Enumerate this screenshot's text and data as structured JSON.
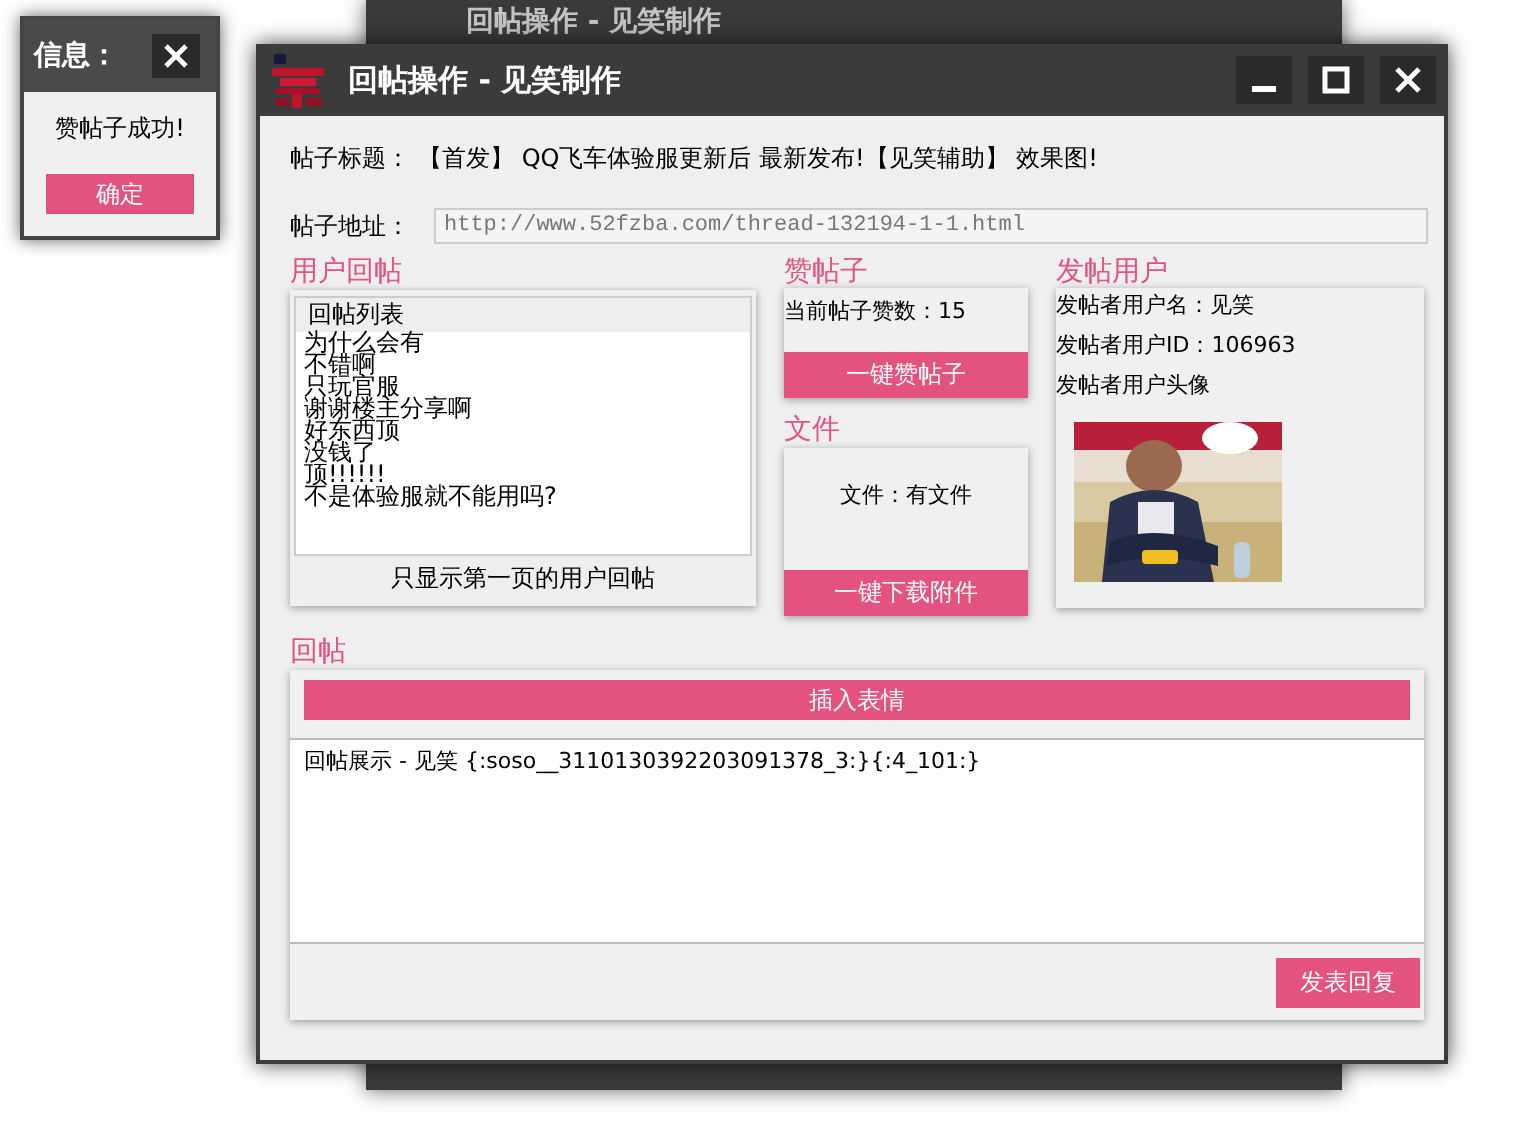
{
  "back_window": {
    "title": "回帖操作 - 见笑制作"
  },
  "info_dialog": {
    "title": "信息：",
    "message": "赞帖子成功!",
    "button": "确定"
  },
  "window": {
    "title": "回帖操作 - 见笑制作"
  },
  "post_title": {
    "label": "帖子标题：",
    "value": "【首发】 QQ飞车体验服更新后 最新发布!【见笑辅助】 效果图!"
  },
  "post_url": {
    "label": "帖子地址：",
    "value": "http://www.52fzba.com/thread-132194-1-1.html"
  },
  "replies_section": {
    "heading": "用户回帖",
    "list_header": "回帖列表",
    "items": [
      "为什么会有",
      "不错啊",
      "只玩官服",
      "谢谢楼主分享啊",
      "好东西顶",
      "没钱了",
      "顶!!!!!!",
      "不是体验服就不能用吗?"
    ],
    "button": "只显示第一页的用户回帖"
  },
  "like_section": {
    "heading": "赞帖子",
    "count": "当前帖子赞数：15",
    "button": "一键赞帖子"
  },
  "file_section": {
    "heading": "文件",
    "status": "文件：有文件",
    "button": "一键下载附件"
  },
  "poster_section": {
    "heading": "发帖用户",
    "name": "发帖者用户名：见笑",
    "id": "发帖者用户ID：106963",
    "avatar_label": "发帖者用户头像"
  },
  "reply_section": {
    "heading": "回帖",
    "insert_button": "插入表情",
    "content": "回帖展示 - 见笑 {:soso__3110130392203091378_3:}{:4_101:}",
    "submit_button": "发表回复"
  }
}
